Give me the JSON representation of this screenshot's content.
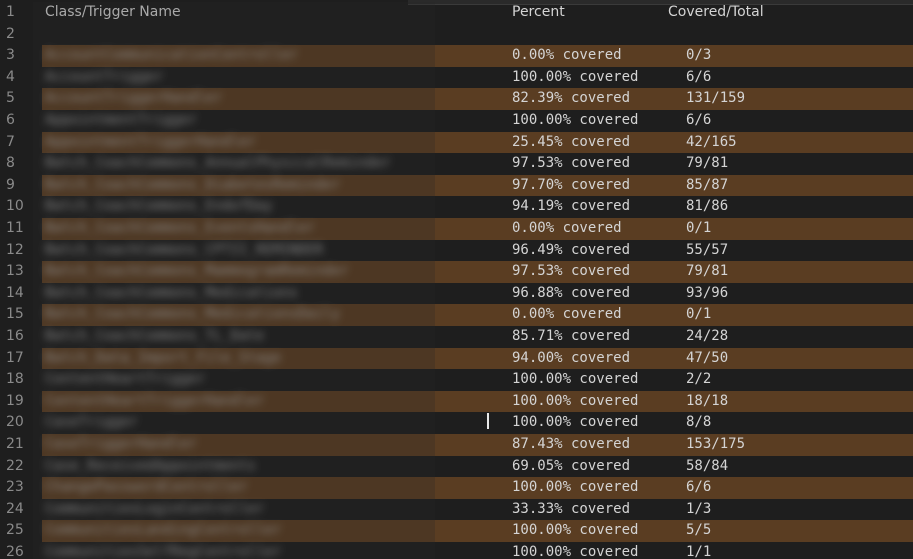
{
  "header": {
    "line_no": "1",
    "name": "Class/Trigger Name",
    "percent": "Percent",
    "covered_total": "Covered/Total"
  },
  "blank_line_no": "2",
  "rows": [
    {
      "line_no": "3",
      "name": "AccountCommunicationController",
      "percent": "0.00% covered",
      "covered": "0/3"
    },
    {
      "line_no": "4",
      "name": "AccountTrigger",
      "percent": "100.00% covered",
      "covered": "6/6"
    },
    {
      "line_no": "5",
      "name": "AccountTriggerHandler",
      "percent": "82.39% covered",
      "covered": "131/159"
    },
    {
      "line_no": "6",
      "name": "AppointmentTrigger",
      "percent": "100.00% covered",
      "covered": "6/6"
    },
    {
      "line_no": "7",
      "name": "AppointmentTriggerHandler",
      "percent": "25.45% covered",
      "covered": "42/165"
    },
    {
      "line_no": "8",
      "name": "Batch_CoachCommons_AnnualPhysicalReminder",
      "percent": "97.53% covered",
      "covered": "79/81"
    },
    {
      "line_no": "9",
      "name": "Batch_CoachCommons_DiabetesReminder",
      "percent": "97.70% covered",
      "covered": "85/87"
    },
    {
      "line_no": "10",
      "name": "Batch_CoachCommons_EndofDay",
      "percent": "94.19% covered",
      "covered": "81/86"
    },
    {
      "line_no": "11",
      "name": "Batch_CoachCommons_EventsHandler",
      "percent": "0.00% covered",
      "covered": "0/1"
    },
    {
      "line_no": "12",
      "name": "Batch_CoachCommons_CPTII_REMINDER",
      "percent": "96.49% covered",
      "covered": "55/57"
    },
    {
      "line_no": "13",
      "name": "Batch_CoachCommons_MammogramReminder",
      "percent": "97.53% covered",
      "covered": "79/81"
    },
    {
      "line_no": "14",
      "name": "Batch_CoachCommons_Medications",
      "percent": "96.88% covered",
      "covered": "93/96"
    },
    {
      "line_no": "15",
      "name": "Batch_CoachCommons_MedicationsDaily",
      "percent": "0.00% covered",
      "covered": "0/1"
    },
    {
      "line_no": "16",
      "name": "Batch_CoachCommons_TL_Date",
      "percent": "85.71% covered",
      "covered": "24/28"
    },
    {
      "line_no": "17",
      "name": "Batch_Data_Import_File_Stage",
      "percent": "94.00% covered",
      "covered": "47/50"
    },
    {
      "line_no": "18",
      "name": "ContentHeartTrigger",
      "percent": "100.00% covered",
      "covered": "2/2"
    },
    {
      "line_no": "19",
      "name": "ContentHeartTriggerHandler",
      "percent": "100.00% covered",
      "covered": "18/18"
    },
    {
      "line_no": "20",
      "name": "CaseTrigger",
      "percent": "100.00% covered",
      "covered": "8/8"
    },
    {
      "line_no": "21",
      "name": "CaseTriggerHandler",
      "percent": "87.43% covered",
      "covered": "153/175"
    },
    {
      "line_no": "22",
      "name": "Case_ReceivedAppointments",
      "percent": "69.05% covered",
      "covered": "58/84"
    },
    {
      "line_no": "23",
      "name": "ChangePasswordController",
      "percent": "100.00% covered",
      "covered": "6/6"
    },
    {
      "line_no": "24",
      "name": "CommunitiesLoginController",
      "percent": "33.33% covered",
      "covered": "1/3"
    },
    {
      "line_no": "25",
      "name": "CommunitiesLandingController",
      "percent": "100.00% covered",
      "covered": "5/5"
    },
    {
      "line_no": "26",
      "name": "CommunitiesSelfRegController",
      "percent": "100.00% covered",
      "covered": "1/1"
    }
  ],
  "colors": {
    "background": "#1e1e1e",
    "stripe": "#5a3d22",
    "text": "#d4d4d4",
    "line_number": "#8a8a8a"
  }
}
